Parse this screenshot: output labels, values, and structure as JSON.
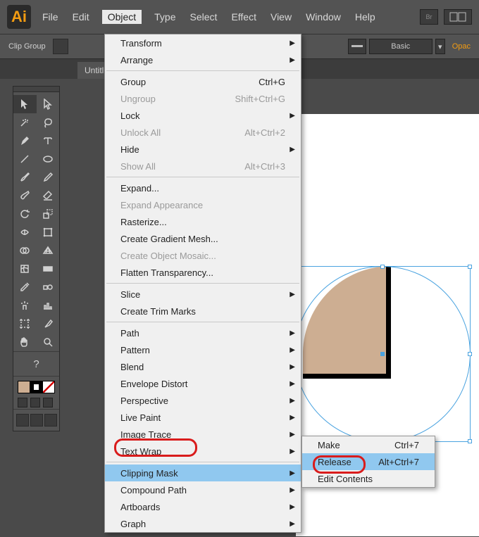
{
  "app": {
    "logo_text": "Ai"
  },
  "menubar": [
    "File",
    "Edit",
    "Object",
    "Type",
    "Select",
    "Effect",
    "View",
    "Window",
    "Help"
  ],
  "active_menu_index": 2,
  "optionsbar": {
    "selection_label": "Clip Group",
    "style_label": "Basic",
    "opacity_label": "Opac"
  },
  "tab": {
    "title": "Untitl"
  },
  "object_menu": [
    {
      "label": "Transform",
      "submenu": true
    },
    {
      "label": "Arrange",
      "submenu": true
    },
    {
      "sep": true
    },
    {
      "label": "Group",
      "shortcut": "Ctrl+G"
    },
    {
      "label": "Ungroup",
      "shortcut": "Shift+Ctrl+G",
      "disabled": true
    },
    {
      "label": "Lock",
      "submenu": true
    },
    {
      "label": "Unlock All",
      "shortcut": "Alt+Ctrl+2",
      "disabled": true
    },
    {
      "label": "Hide",
      "submenu": true
    },
    {
      "label": "Show All",
      "shortcut": "Alt+Ctrl+3",
      "disabled": true
    },
    {
      "sep": true
    },
    {
      "label": "Expand..."
    },
    {
      "label": "Expand Appearance",
      "disabled": true
    },
    {
      "label": "Rasterize..."
    },
    {
      "label": "Create Gradient Mesh..."
    },
    {
      "label": "Create Object Mosaic...",
      "disabled": true
    },
    {
      "label": "Flatten Transparency..."
    },
    {
      "sep": true
    },
    {
      "label": "Slice",
      "submenu": true
    },
    {
      "label": "Create Trim Marks"
    },
    {
      "sep": true
    },
    {
      "label": "Path",
      "submenu": true
    },
    {
      "label": "Pattern",
      "submenu": true
    },
    {
      "label": "Blend",
      "submenu": true
    },
    {
      "label": "Envelope Distort",
      "submenu": true
    },
    {
      "label": "Perspective",
      "submenu": true
    },
    {
      "label": "Live Paint",
      "submenu": true
    },
    {
      "label": "Image Trace",
      "submenu": true
    },
    {
      "label": "Text Wrap",
      "submenu": true
    },
    {
      "sep": true
    },
    {
      "label": "Clipping Mask",
      "submenu": true,
      "hover": true
    },
    {
      "label": "Compound Path",
      "submenu": true
    },
    {
      "label": "Artboards",
      "submenu": true
    },
    {
      "label": "Graph",
      "submenu": true
    }
  ],
  "clipping_submenu": [
    {
      "label": "Make",
      "shortcut": "Ctrl+7"
    },
    {
      "label": "Release",
      "shortcut": "Alt+Ctrl+7",
      "hover": true
    },
    {
      "label": "Edit Contents"
    }
  ],
  "swatches": {
    "fill": "#cdae92",
    "stroke": "#000000",
    "none": "none"
  }
}
